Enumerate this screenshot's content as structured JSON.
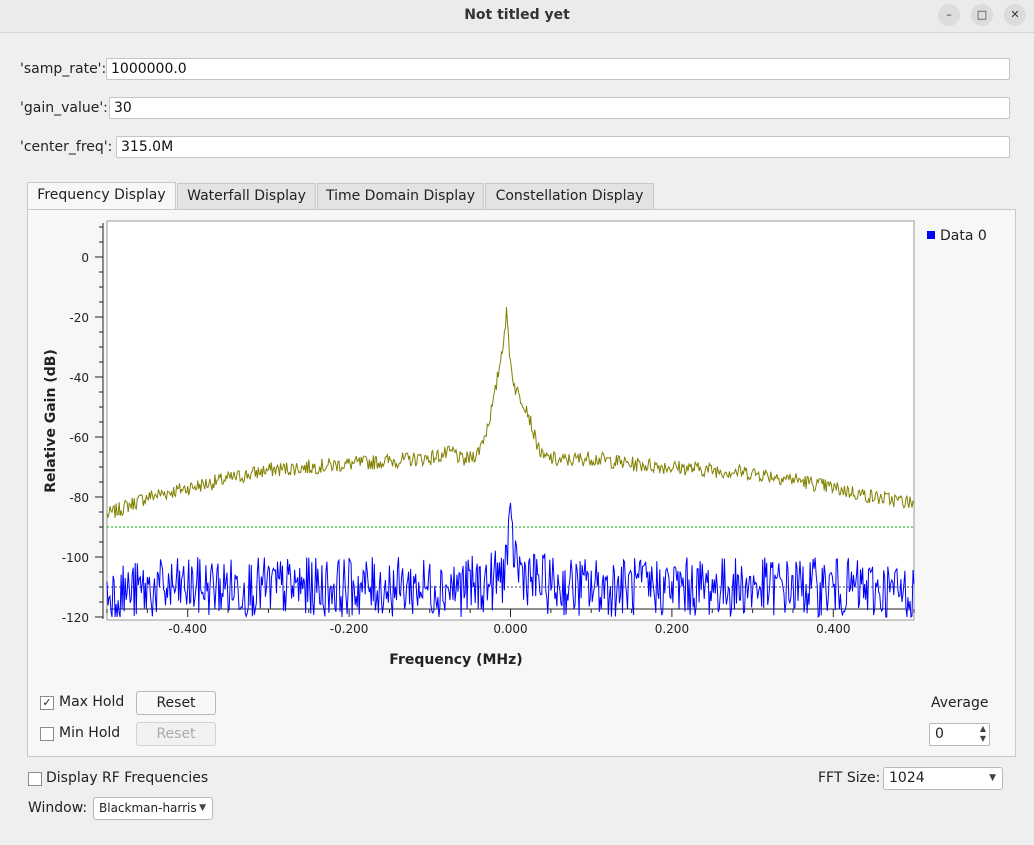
{
  "window": {
    "title": "Not titled yet"
  },
  "variables": [
    {
      "label": "'samp_rate':",
      "value": "1000000.0"
    },
    {
      "label": "'gain_value':",
      "value": "30"
    },
    {
      "label": "'center_freq':",
      "value": "315.0M"
    }
  ],
  "tabs": [
    "Frequency Display",
    "Waterfall Display",
    "Time Domain Display",
    "Constellation Display"
  ],
  "controls": {
    "max_hold": "Max Hold",
    "min_hold": "Min Hold",
    "reset": "Reset",
    "average_label": "Average",
    "average_value": "0",
    "display_rf": "Display RF Frequencies",
    "fft_label": "FFT Size:",
    "fft_value": "1024",
    "window_label": "Window:",
    "window_value": "Blackman-harris"
  },
  "chart_data": {
    "type": "line",
    "xlabel": "Frequency (MHz)",
    "ylabel": "Relative Gain (dB)",
    "xlim": [
      -0.5,
      0.5
    ],
    "ylim": [
      -121,
      12
    ],
    "xticks": [
      "-0.400",
      "-0.200",
      "0.000",
      "0.200",
      "0.400"
    ],
    "xtick_values": [
      -0.4,
      -0.2,
      0.0,
      0.2,
      0.4
    ],
    "yticks": [
      "0",
      "-20",
      "-40",
      "-60",
      "-80",
      "-100",
      "-120"
    ],
    "ytick_values": [
      0,
      -20,
      -40,
      -60,
      -80,
      -100,
      -120
    ],
    "legend": {
      "label": "Data 0",
      "position": "top-right",
      "color": "#0000ff"
    },
    "max_hold_level": -90,
    "average_level": -110,
    "series": [
      {
        "name": "Data 0",
        "color": "#0000ff",
        "x": [
          -0.5,
          -0.45,
          -0.4,
          -0.35,
          -0.3,
          -0.25,
          -0.2,
          -0.15,
          -0.1,
          -0.06,
          -0.03,
          -0.01,
          0.0,
          0.01,
          0.03,
          0.06,
          0.1,
          0.15,
          0.2,
          0.25,
          0.3,
          0.35,
          0.4,
          0.45,
          0.5
        ],
        "values": [
          -112,
          -111,
          -110,
          -110,
          -110,
          -110,
          -110,
          -110,
          -110,
          -110,
          -109,
          -106,
          -92,
          -104,
          -108,
          -110,
          -110,
          -110,
          -110,
          -110,
          -110,
          -110,
          -110,
          -111,
          -112
        ]
      },
      {
        "name": "Max Hold",
        "color": "#808000",
        "x": [
          -0.5,
          -0.45,
          -0.4,
          -0.35,
          -0.3,
          -0.25,
          -0.2,
          -0.15,
          -0.1,
          -0.07,
          -0.06,
          -0.05,
          -0.04,
          -0.03,
          -0.02,
          -0.01,
          -0.005,
          0.0,
          0.005,
          0.01,
          0.02,
          0.03,
          0.04,
          0.05,
          0.06,
          0.1,
          0.15,
          0.2,
          0.25,
          0.3,
          0.35,
          0.4,
          0.45,
          0.5
        ],
        "values": [
          -86,
          -80,
          -77,
          -74,
          -71,
          -70,
          -69,
          -68,
          -67,
          -65,
          -68,
          -67,
          -65,
          -58,
          -47,
          -30,
          -19,
          -35,
          -43,
          -46,
          -50,
          -60,
          -67,
          -67,
          -68,
          -67,
          -69,
          -70,
          -71,
          -72,
          -74,
          -77,
          -80,
          -82
        ]
      }
    ]
  }
}
